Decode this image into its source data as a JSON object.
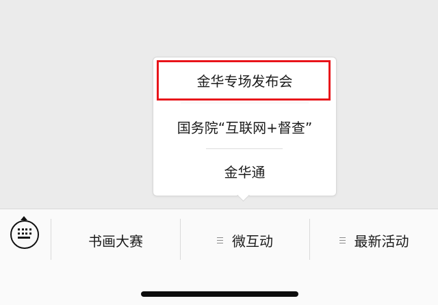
{
  "submenu": {
    "items": [
      {
        "label": "金华专场发布会",
        "highlighted": true
      },
      {
        "label": "国务院“互联网+督查”"
      },
      {
        "label": "金华通"
      }
    ],
    "highlight_color": "#e8141a"
  },
  "menubar": {
    "keyboard_toggle_icon": "keyboard-icon",
    "items": [
      {
        "label": "书画大赛",
        "has_submenu": false
      },
      {
        "label": "微互动",
        "has_submenu": true,
        "icon": "menu-lines-icon"
      },
      {
        "label": "最新活动",
        "has_submenu": true,
        "icon": "menu-lines-icon"
      }
    ]
  }
}
